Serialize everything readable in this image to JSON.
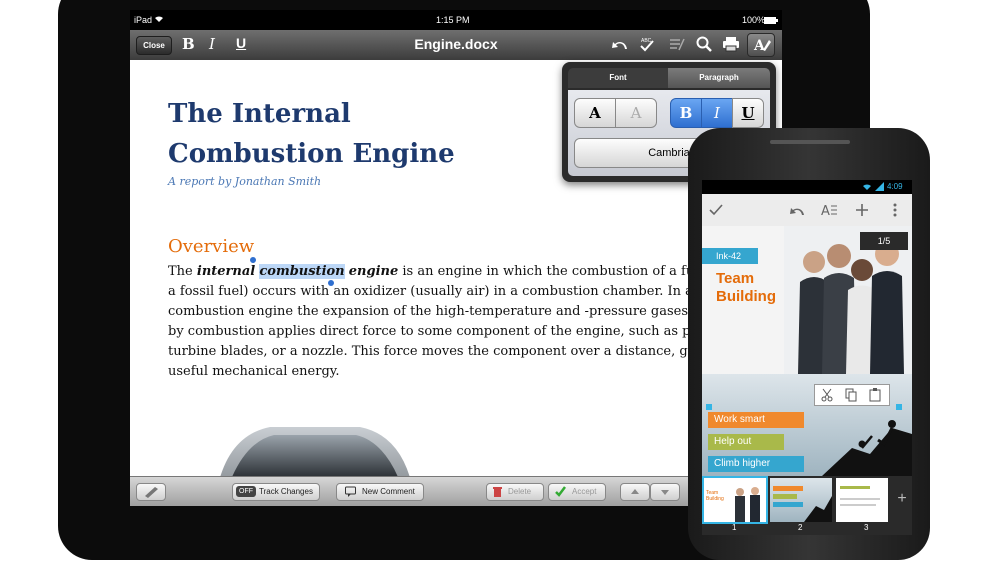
{
  "ipad": {
    "status": {
      "carrier": "iPad",
      "time": "1:15 PM",
      "battery": "100%"
    },
    "toolbar": {
      "close_label": "Close",
      "bold": "B",
      "italic": "I",
      "underline": "U",
      "doc_title": "Engine.docx"
    },
    "document": {
      "title_line1": "The Internal",
      "title_line2": "Combustion Engine",
      "subtitle": "A report by Jonathan Smith",
      "heading": "Overview",
      "line1_pre": "The ",
      "line1_b1": "internal",
      "line1_sp1": " ",
      "line1_sel": "combustion",
      "line1_sp2": " ",
      "line1_b2": "engine",
      "line1_post": " is an engine in which the combustion of a fuel (n",
      "line2": "a fossil fuel) occurs with an oxidizer (usually air) in a combustion chamber. In an in",
      "line3": "combustion engine the expansion of the high-temperature and -pressure gases prod",
      "line4": "by combustion applies direct force to some component of the engine, such as pistor",
      "line5": "turbine blades, or a nozzle. This force moves the component over a distance, gener",
      "line6": "useful mechanical energy."
    },
    "popover": {
      "tab_font": "Font",
      "tab_paragraph": "Paragraph",
      "font_a": "A",
      "font_a2": "A",
      "bold": "B",
      "italic": "I",
      "underline": "U",
      "font_name": "Cambria"
    },
    "bottom_bar": {
      "toggle": "OFF",
      "track_changes": "Track Changes",
      "new_comment": "New Comment",
      "delete": "Delete",
      "accept": "Accept"
    }
  },
  "phone": {
    "status": {
      "time": "4:09"
    },
    "slide_counter": "1/5",
    "slide": {
      "tag": "Ink-42",
      "title_line1": "Team",
      "title_line2": "Building"
    },
    "slide2": {
      "item1": "Work smart",
      "item2": "Help out",
      "item3": "Climb higher"
    },
    "thumbs": [
      {
        "num": "1",
        "mini_title": "Team Building"
      },
      {
        "num": "2"
      },
      {
        "num": "3"
      }
    ],
    "add_slide": "+"
  },
  "colors": {
    "title_blue": "#1e3a6e",
    "heading_orange": "#e46c0a",
    "subtitle_blue": "#4a77b4",
    "selection": "#bcd7f7",
    "accent_blue": "#2f6fd0"
  }
}
